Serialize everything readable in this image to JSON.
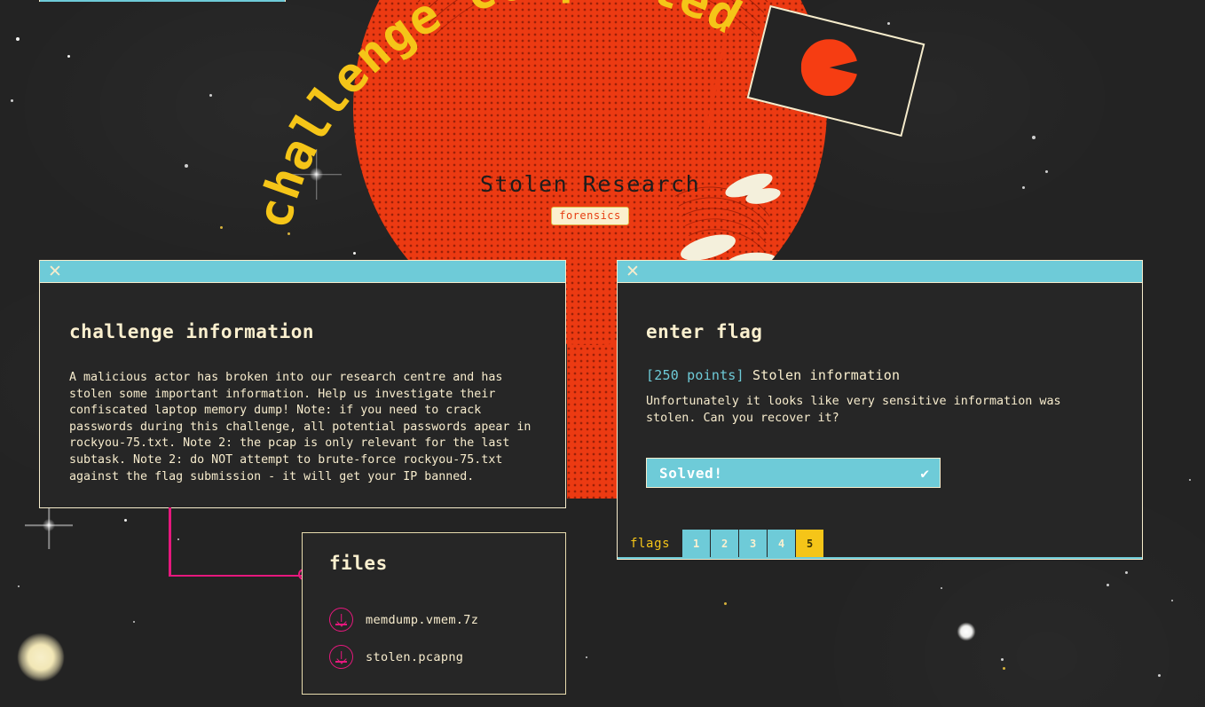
{
  "banner": {
    "text": "challenge completed",
    "color": "#f5c518"
  },
  "planet": {
    "title": "Stolen Research",
    "category": "forensics",
    "color": "#ec3a12",
    "title_color": "#1d1d1d",
    "badge_bg": "#fbf0cf",
    "badge_color": "#e63d11"
  },
  "decoration": {
    "flag_icon": "planted-flag-icon",
    "pacman_icon": "pacman-icon"
  },
  "windows": {
    "info": {
      "close_icon": "✕",
      "heading": "challenge information",
      "body": "A malicious actor has broken into our research centre and has stolen some important information. Help us investigate their confiscated laptop memory dump! Note: if you need to crack passwords during this challenge, all potential passwords apear in rockyou-75.txt. Note 2: the pcap is only relevant for the last subtask. Note 2: do NOT attempt to brute-force rockyou-75.txt against the flag submission - it will get your IP banned."
    },
    "files": {
      "heading": "files",
      "items": [
        {
          "name": "memdump.vmem.7z",
          "icon": "download-icon"
        },
        {
          "name": "stolen.pcapng",
          "icon": "download-icon"
        }
      ]
    },
    "flag": {
      "close_icon": "✕",
      "heading": "enter flag",
      "subtask_points": "[250 points]",
      "subtask_name": "Stolen information",
      "subtask_desc": "Unfortunately it looks like very sensitive information was stolen. Can you recover it?",
      "solved_label": "Solved!",
      "solved_icon": "✔",
      "tabs_label": "flags",
      "tabs": [
        {
          "label": "1",
          "active": false
        },
        {
          "label": "2",
          "active": false
        },
        {
          "label": "3",
          "active": false
        },
        {
          "label": "4",
          "active": false
        },
        {
          "label": "5",
          "active": true
        }
      ]
    }
  },
  "theme": {
    "background": "#242424",
    "panel_bg": "#262626",
    "border": "#f6eccc",
    "accent_teal": "#6ecbd8",
    "accent_yellow": "#f5c518",
    "accent_magenta": "#e6187d",
    "text": "#f7eccd"
  }
}
